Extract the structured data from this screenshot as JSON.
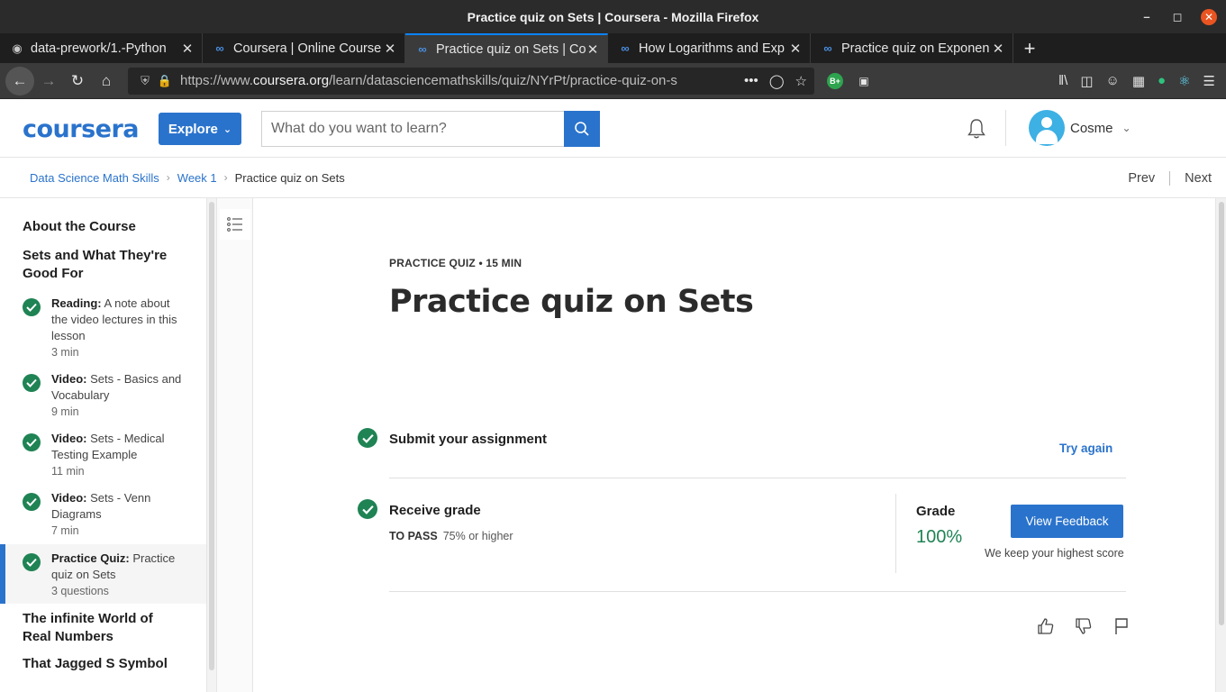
{
  "window": {
    "title": "Practice quiz on Sets | Coursera - Mozilla Firefox"
  },
  "tabs": [
    {
      "title": "data-prework/1.-Python",
      "icon": "github-icon"
    },
    {
      "title": "Coursera | Online Course",
      "icon": "coursera-icon"
    },
    {
      "title": "Practice quiz on Sets | Co",
      "icon": "coursera-icon",
      "active": true
    },
    {
      "title": "How Logarithms and Exp",
      "icon": "coursera-icon"
    },
    {
      "title": "Practice quiz on Exponen",
      "icon": "coursera-icon"
    }
  ],
  "url": {
    "prefix": "https://www.",
    "domain": "coursera.org",
    "path": "/learn/datasciencemathskills/quiz/NYrPt/practice-quiz-on-s"
  },
  "extensions": {
    "badge": "B+"
  },
  "header": {
    "logo": "coursera",
    "explore_label": "Explore",
    "search_placeholder": "What do you want to learn?",
    "user_name": "Cosme"
  },
  "breadcrumb": {
    "course": "Data Science Math Skills",
    "week": "Week 1",
    "current": "Practice quiz on Sets",
    "prev": "Prev",
    "next": "Next"
  },
  "sidebar": {
    "about": "About the Course",
    "section1": "Sets and What They're Good For",
    "items": [
      {
        "type": "Reading:",
        "title": "A note about the video lectures in this lesson",
        "meta": "3 min"
      },
      {
        "type": "Video:",
        "title": "Sets - Basics and Vocabulary",
        "meta": "9 min"
      },
      {
        "type": "Video:",
        "title": "Sets - Medical Testing Example",
        "meta": "11 min"
      },
      {
        "type": "Video:",
        "title": "Sets - Venn Diagrams",
        "meta": "7 min"
      },
      {
        "type": "Practice Quiz:",
        "title": "Practice quiz on Sets",
        "meta": "3 questions"
      }
    ],
    "section2": "The infinite World of Real Numbers",
    "section3": "That Jagged S Symbol"
  },
  "main": {
    "kicker": "PRACTICE QUIZ • 15 MIN",
    "title": "Practice quiz on Sets",
    "submit_label": "Submit your assignment",
    "try_again": "Try again",
    "receive_label": "Receive grade",
    "to_pass_label": "TO PASS",
    "to_pass_value": "75% or higher",
    "grade_label": "Grade",
    "grade_value": "100%",
    "view_feedback": "View Feedback",
    "keep_note": "We keep your highest score"
  },
  "colors": {
    "brand": "#2a73cc",
    "success": "#1f8354",
    "tab_accent": "#0a84ff"
  }
}
